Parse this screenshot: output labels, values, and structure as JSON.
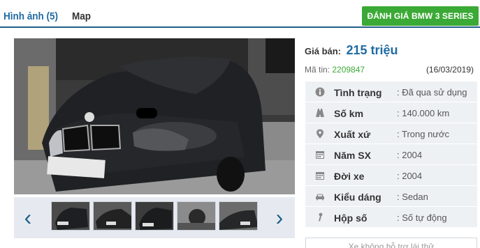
{
  "tabs": {
    "photos_label": "Hình ảnh (5)",
    "map_label": "Map",
    "review_button": "ĐÁNH GIÁ BMW 3 SERIES"
  },
  "gallery": {
    "prev_icon": "chevron-left-icon",
    "next_icon": "chevron-right-icon",
    "thumbnail_count": 5
  },
  "listing": {
    "price_label": "Giá bán:",
    "price_value": "215 triệu",
    "code_label": "Mã tin:",
    "code_value": "2209847",
    "date": "(16/03/2019)"
  },
  "specs": [
    {
      "icon": "info-icon",
      "label": "Tình trạng",
      "value": ": Đã qua sử dụng"
    },
    {
      "icon": "road-icon",
      "label": "Số km",
      "value": ": 140.000 km"
    },
    {
      "icon": "map-pin-icon",
      "label": "Xuất xứ",
      "value": ": Trong nước"
    },
    {
      "icon": "calendar-icon",
      "label": "Năm SX",
      "value": ": 2004"
    },
    {
      "icon": "calendar-icon",
      "label": "Đời xe",
      "value": ": 2004"
    },
    {
      "icon": "car-icon",
      "label": "Kiểu dáng",
      "value": ": Sedan"
    },
    {
      "icon": "gear-shift-icon",
      "label": "Hộp số",
      "value": ": Số tự động"
    }
  ],
  "test_drive_button": "Xe không hỗ trợ lái thử",
  "colors": {
    "accent_blue": "#1f6ba3",
    "green": "#3ba935"
  }
}
